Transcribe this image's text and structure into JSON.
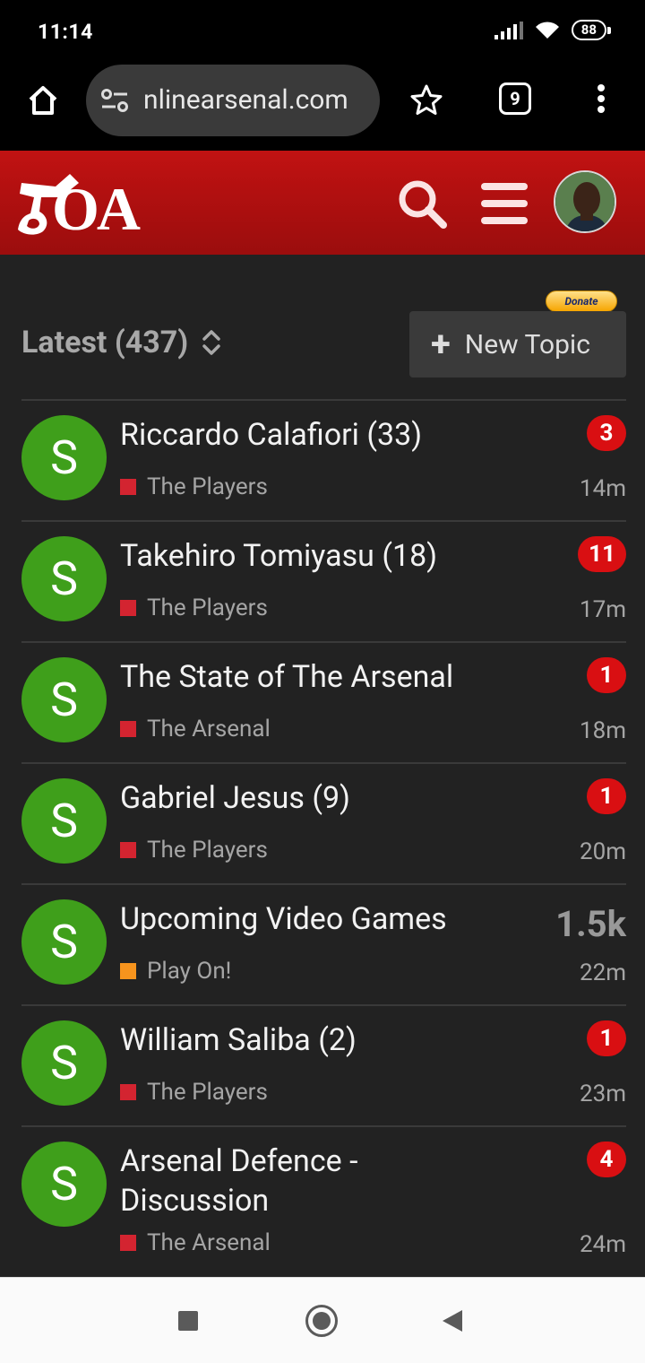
{
  "status_bar": {
    "time": "11:14",
    "battery": "88"
  },
  "browser": {
    "url": "nlinearsenal.com",
    "tab_count": "9"
  },
  "site": {
    "logo_text": "OA",
    "avatar_alt": "user avatar"
  },
  "toolbar": {
    "donate_label": "Donate",
    "latest_label": "Latest (437)",
    "new_topic_label": "New Topic"
  },
  "colors": {
    "header_red": "#b01010",
    "avatar_green": "#3f9f1b",
    "badge_red": "#d90f12",
    "cat_players": "#d32430",
    "cat_arsenal": "#d32430",
    "cat_playon": "#f7941d"
  },
  "topics": [
    {
      "avatar_letter": "S",
      "title": "Riccardo Calafiori (33)",
      "category": "The Players",
      "cat_color": "#d32430",
      "badge": "3",
      "age": "14m"
    },
    {
      "avatar_letter": "S",
      "title": "Takehiro Tomiyasu (18)",
      "category": "The Players",
      "cat_color": "#d32430",
      "badge": "11",
      "age": "17m"
    },
    {
      "avatar_letter": "S",
      "title": "The State of The Arsenal",
      "category": "The Arsenal",
      "cat_color": "#d32430",
      "badge": "1",
      "age": "18m"
    },
    {
      "avatar_letter": "S",
      "title": "Gabriel Jesus (9)",
      "category": "The Players",
      "cat_color": "#d32430",
      "badge": "1",
      "age": "20m"
    },
    {
      "avatar_letter": "S",
      "title": "Upcoming Video Games",
      "category": "Play On!",
      "cat_color": "#f7941d",
      "count": "1.5k",
      "age": "22m"
    },
    {
      "avatar_letter": "S",
      "title": "William Saliba (2)",
      "category": "The Players",
      "cat_color": "#d32430",
      "badge": "1",
      "age": "23m"
    },
    {
      "avatar_letter": "S",
      "title": "Arsenal Defence - Discussion",
      "category": "The Arsenal",
      "cat_color": "#d32430",
      "badge": "4",
      "age": "24m"
    }
  ]
}
